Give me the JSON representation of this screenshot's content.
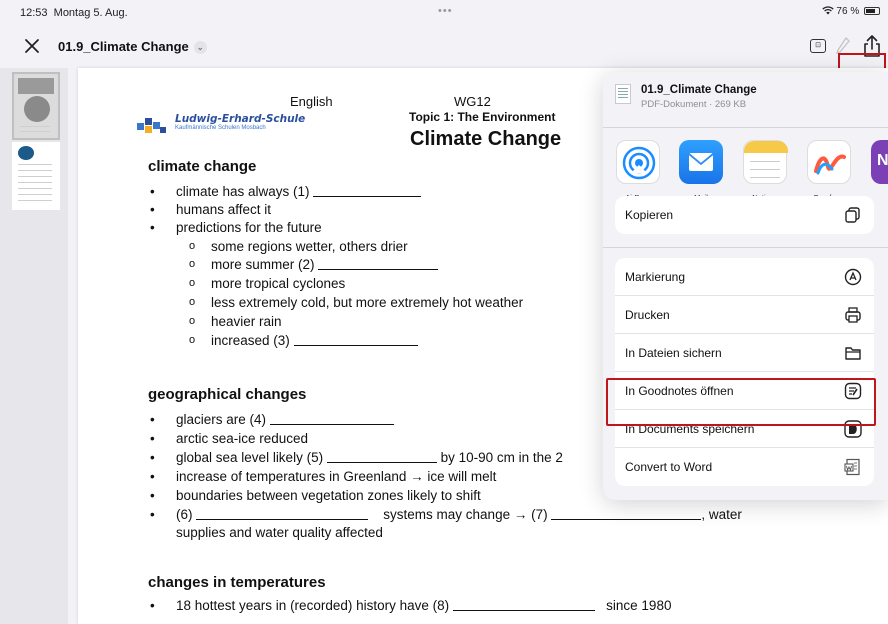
{
  "status_bar": {
    "time": "12:53",
    "date": "Montag 5. Aug.",
    "battery_text": "76 %",
    "battery_level": 0.76,
    "multitask_dots": "•••"
  },
  "nav": {
    "title": "01.9_Climate Change",
    "chevron": "⌄",
    "reader_glyph": "⊡"
  },
  "document": {
    "header": {
      "subject": "English",
      "class": "WG12",
      "topic": "Topic 1: The Environment",
      "title": "Climate Change"
    },
    "logo": {
      "name": "Ludwig-Erhard-Schule",
      "subtitle": "Kaufmännische Schulen Mosbach"
    },
    "sections": [
      {
        "heading": "climate change",
        "items": [
          "climate has always (1)",
          "humans affect it",
          "predictions for the future"
        ],
        "subitems": [
          "some regions wetter, others drier",
          "more summer (2)",
          "more tropical cyclones",
          "less extremely cold, but more extremely hot weather",
          "heavier rain",
          "increased (3)"
        ]
      },
      {
        "heading": "geographical changes",
        "items": [
          "glaciers are (4)",
          "arctic sea-ice reduced",
          "global sea level likely (5)",
          "by 10-90 cm in the 2",
          "increase of temperatures in Greenland → ice will melt",
          "boundaries between vegetation zones likely to shift",
          "(6)",
          "systems may change → (7)",
          ", water",
          "supplies and water quality affected"
        ]
      },
      {
        "heading": "changes in temperatures",
        "items": [
          "18 hottest years in (recorded) history have (8)",
          "since 1980"
        ]
      }
    ]
  },
  "share_sheet": {
    "file_name": "01.9_Climate Change",
    "file_meta": "PDF-Dokument · 269 KB",
    "apps": [
      {
        "label": "AirDrop",
        "icon": "airdrop-icon",
        "color": "#1a8cff"
      },
      {
        "label": "Mail",
        "icon": "mail-icon",
        "color": "#2f8ef5"
      },
      {
        "label": "Notizen",
        "icon": "notes-icon",
        "color": "#f7c948"
      },
      {
        "label": "Freeform",
        "icon": "freeform-icon",
        "color": "#ffffff"
      },
      {
        "label": "O",
        "icon": "onenote-icon",
        "color": "#7b3fb6"
      }
    ],
    "actions_group1": [
      {
        "label": "Kopieren",
        "icon": "copy-icon"
      }
    ],
    "actions_group2": [
      {
        "label": "Markierung",
        "icon": "markup-icon"
      },
      {
        "label": "Drucken",
        "icon": "print-icon"
      },
      {
        "label": "In Dateien sichern",
        "icon": "folder-icon"
      },
      {
        "label": "In Goodnotes öffnen",
        "icon": "goodnotes-icon"
      },
      {
        "label": "In Documents speichern",
        "icon": "documents-icon"
      },
      {
        "label": "Convert to Word",
        "icon": "word-icon"
      }
    ]
  },
  "highlight_color": "#c0151b"
}
